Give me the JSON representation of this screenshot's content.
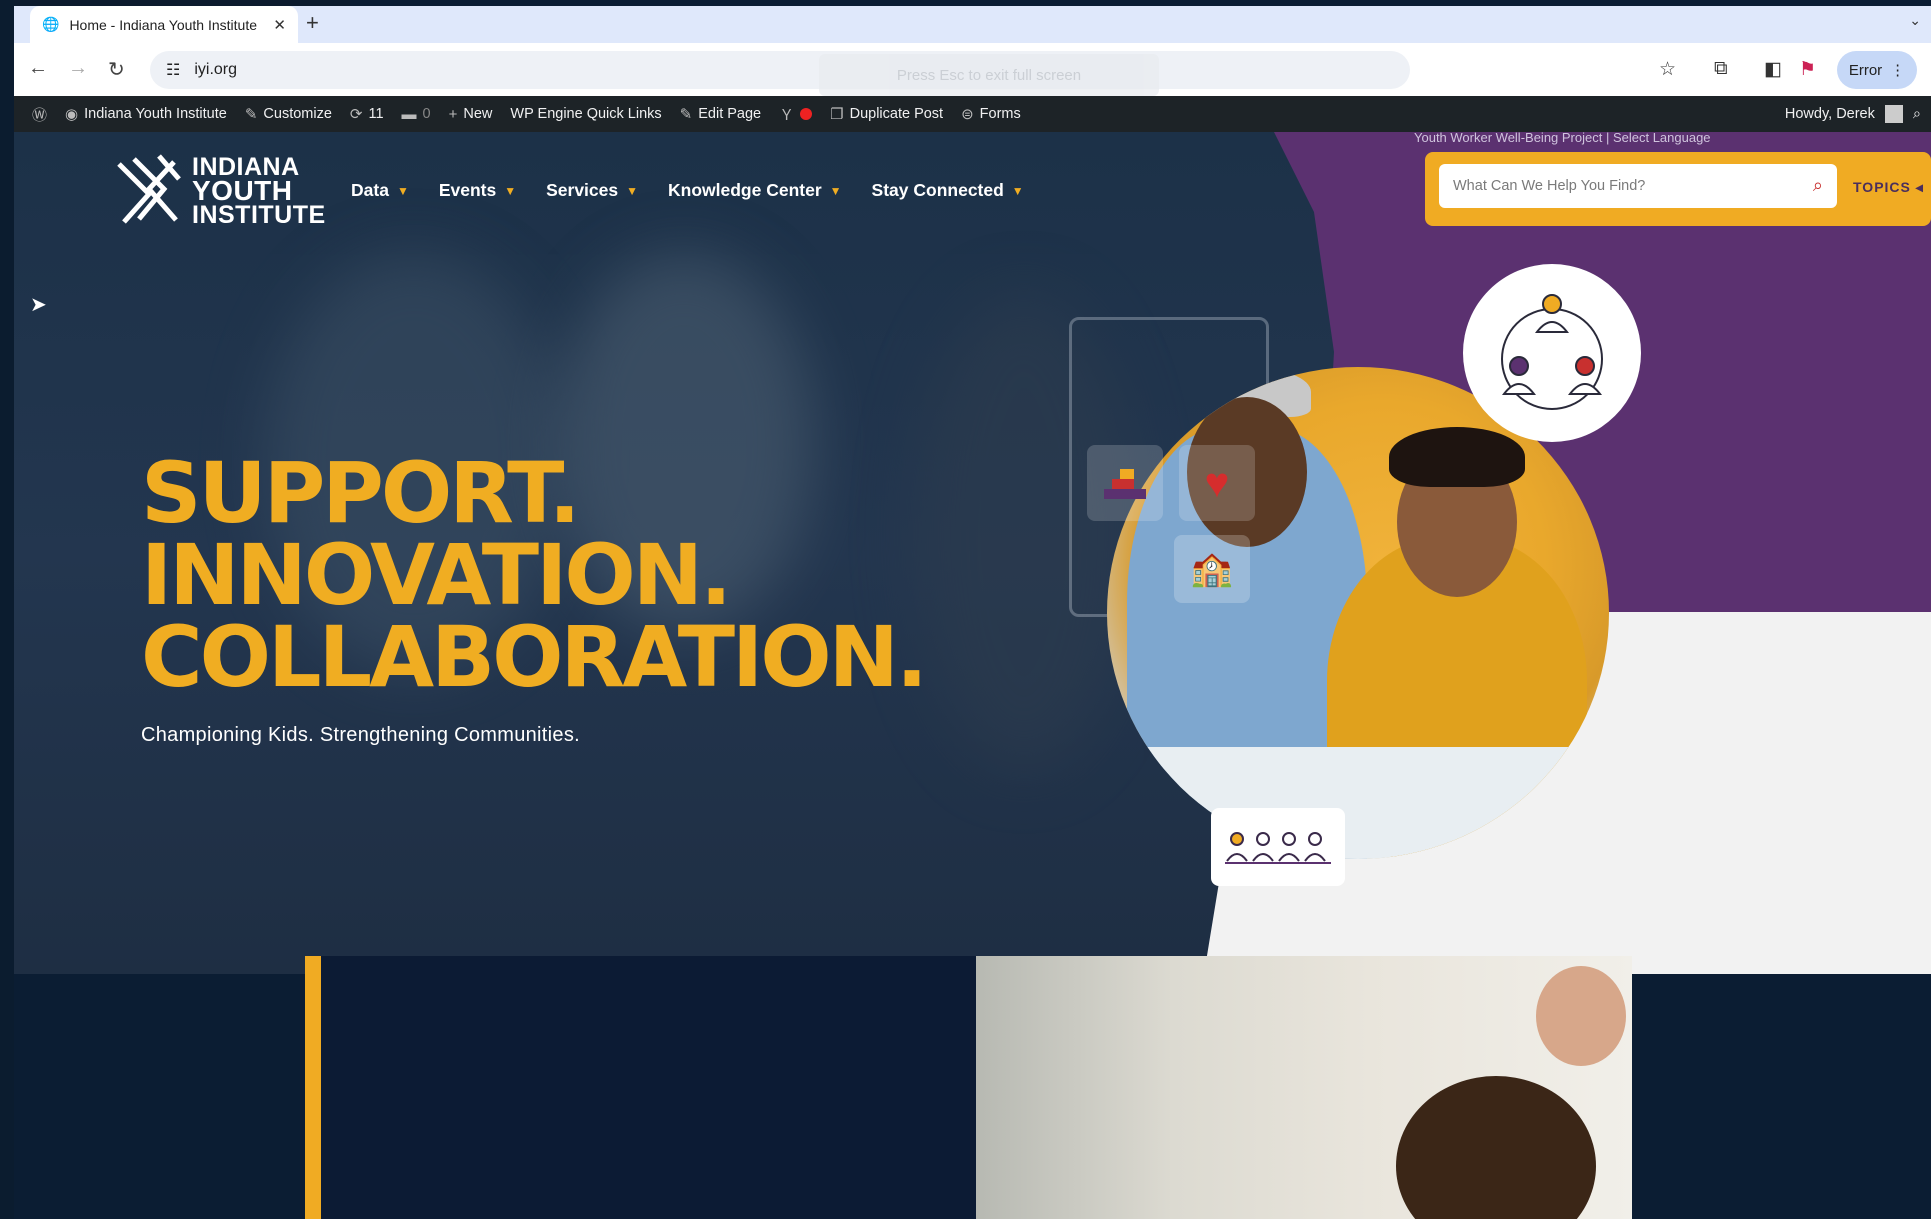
{
  "browser": {
    "tab_title": "Home - Indiana Youth Institute",
    "url": "iyi.org",
    "fullscreen_hint": "Press Esc to exit full screen",
    "profile_button": "Error"
  },
  "wp_admin_bar": {
    "site_name": "Indiana Youth Institute",
    "customize": "Customize",
    "updates_count": "11",
    "comments_count": "0",
    "new": "New",
    "wp_engine": "WP Engine Quick Links",
    "edit_page": "Edit Page",
    "duplicate_post": "Duplicate Post",
    "forms": "Forms",
    "howdy": "Howdy, Derek"
  },
  "site": {
    "top_links": "Youth Worker Well-Being Project   |   Select Language",
    "logo_line1": "INDIANA",
    "logo_line2": "YOUTH",
    "logo_line3": "INSTITUTE",
    "nav": [
      "Data",
      "Events",
      "Services",
      "Knowledge Center",
      "Stay Connected"
    ],
    "search_placeholder": "What Can We Help You Find?",
    "topics_label": "TOPICS",
    "headline": [
      "SUPPORT.",
      "INNOVATION.",
      "COLLABORATION."
    ],
    "subheadline": "Championing Kids. Strengthening Communities."
  },
  "colors": {
    "accent_gold": "#f0ad22",
    "navy": "#0c1b34",
    "purple": "#5b3170",
    "wp_bar": "#1d2327"
  }
}
